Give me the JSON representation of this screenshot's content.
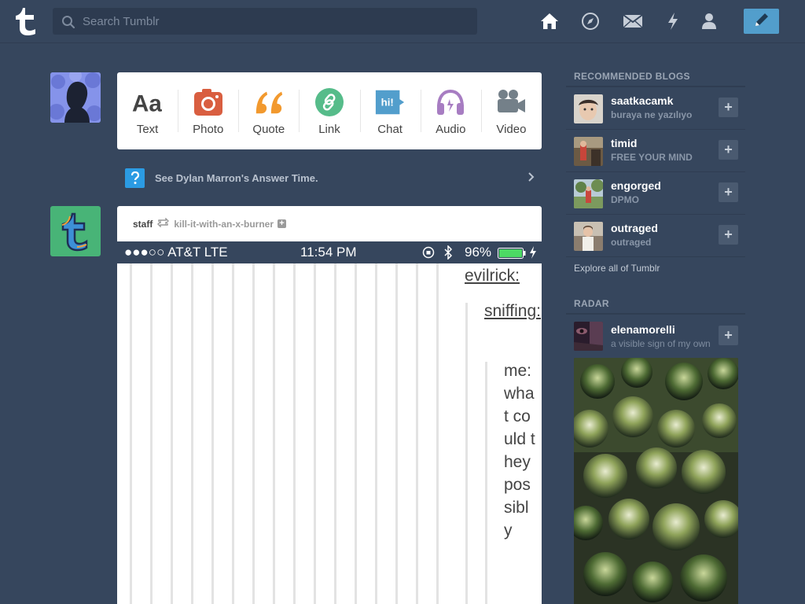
{
  "header": {
    "search_placeholder": "Search Tumblr",
    "nav": [
      "home-icon",
      "explore-icon",
      "inbox-icon",
      "activity-icon",
      "account-icon"
    ],
    "compose": "compose-pencil-icon"
  },
  "post_types": [
    {
      "label": "Text",
      "icon": "text-icon",
      "color": "#444444"
    },
    {
      "label": "Photo",
      "icon": "camera-icon",
      "color": "#d95e40"
    },
    {
      "label": "Quote",
      "icon": "quote-icon",
      "color": "#f2992e"
    },
    {
      "label": "Link",
      "icon": "link-icon",
      "color": "#56bc8a"
    },
    {
      "label": "Chat",
      "icon": "chat-icon",
      "color": "#529ecc"
    },
    {
      "label": "Audio",
      "icon": "headphones-icon",
      "color": "#a77dc2"
    },
    {
      "label": "Video",
      "icon": "video-camera-icon",
      "color": "#748089"
    }
  ],
  "answer_time": {
    "text": "See Dylan Marron's Answer Time."
  },
  "post": {
    "author": "staff",
    "source": "kill-it-with-an-x-burner",
    "statusbar": {
      "carrier": "●●●○○ AT&T  LTE",
      "time": "11:54 PM",
      "battery": "96%"
    },
    "conversation": {
      "user1": "evilrick:",
      "user2": "sniffing:",
      "message": "me: what could they possibly"
    }
  },
  "sidebar": {
    "recommended_title": "RECOMMENDED BLOGS",
    "blogs": [
      {
        "name": "saatkacamk",
        "subtitle": "buraya ne yazılıyo"
      },
      {
        "name": "timid",
        "subtitle": "FREE YOUR MIND"
      },
      {
        "name": "engorged",
        "subtitle": "DPMO"
      },
      {
        "name": "outraged",
        "subtitle": "outraged"
      }
    ],
    "explore": "Explore all of Tumblr",
    "radar_title": "RADAR",
    "radar_blog": {
      "name": "elenamorelli",
      "subtitle": "a visible sign of my own"
    }
  },
  "colors": {
    "background": "#36465d",
    "accent": "#529ecc",
    "card": "#ffffff"
  }
}
